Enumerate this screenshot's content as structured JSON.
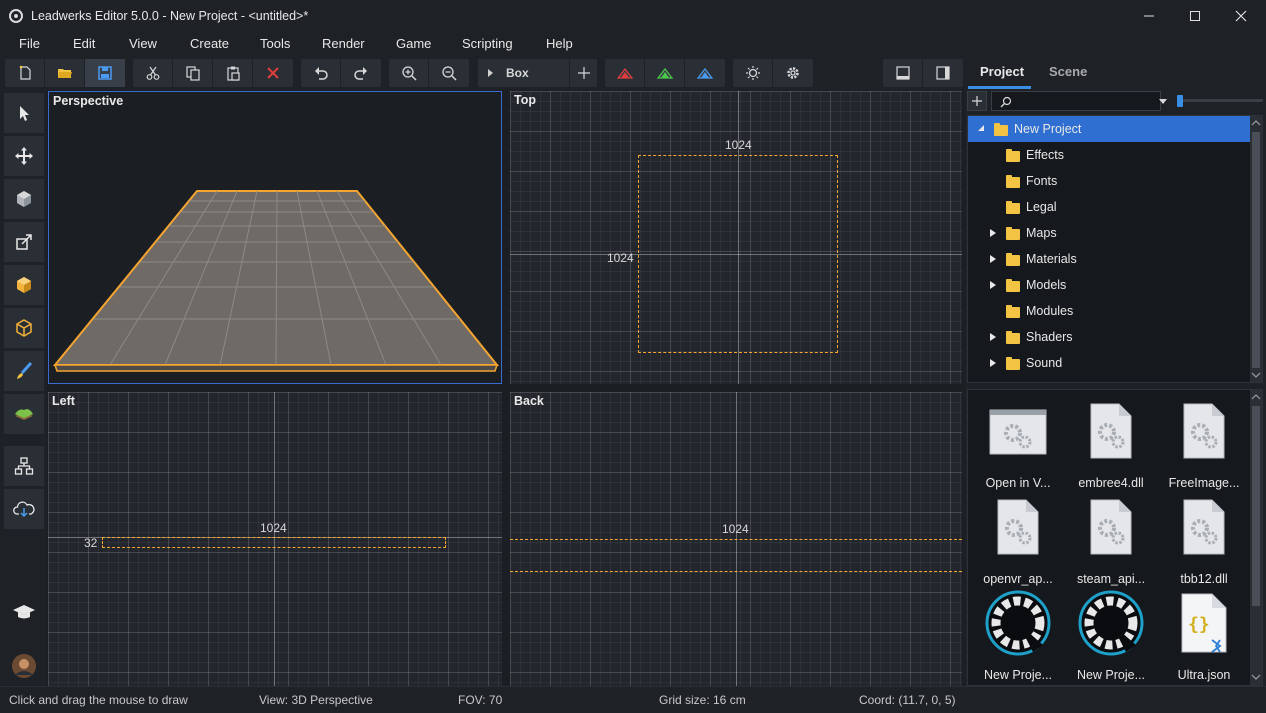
{
  "window": {
    "title": "Leadwerks Editor 5.0.0 - New Project - <untitled>*"
  },
  "menu": [
    "File",
    "Edit",
    "View",
    "Create",
    "Tools",
    "Render",
    "Game",
    "Scripting",
    "Help"
  ],
  "toolbar": {
    "primitive_selector": "Box",
    "icons": [
      "new-file-icon",
      "open-folder-icon",
      "save-icon",
      "cut-icon",
      "copy-icon",
      "paste-icon",
      "delete-icon",
      "undo-icon",
      "redo-icon",
      "zoom-in-icon",
      "zoom-out-icon",
      "play-icon",
      "add-icon",
      "align-red-icon",
      "align-green-icon",
      "align-blue-icon",
      "settings-sun-icon",
      "settings-gear-icon",
      "single-view-icon",
      "panel-view-icon"
    ]
  },
  "tools": [
    "select-arrow-icon",
    "move-icon",
    "rotate-cube-icon",
    "scale-icon",
    "box-solid-icon",
    "box-edit-icon",
    "paint-brush-icon",
    "terrain-icon",
    "hierarchy-icon",
    "cloud-download-icon",
    "graduation-cap-icon",
    "user-avatar"
  ],
  "viewports": {
    "perspective": {
      "label": "Perspective"
    },
    "top": {
      "label": "Top",
      "width_label": "1024",
      "height_label": "1024"
    },
    "left": {
      "label": "Left",
      "width_label": "1024",
      "height_label": "32"
    },
    "back": {
      "label": "Back",
      "width_label": "1024"
    }
  },
  "panel": {
    "tabs": [
      "Project",
      "Scene"
    ],
    "active_tab": "Project",
    "tree": [
      {
        "label": "New Project",
        "expanded": true,
        "selected": true,
        "depth": 0
      },
      {
        "label": "Effects",
        "expandable": false,
        "depth": 1
      },
      {
        "label": "Fonts",
        "expandable": false,
        "depth": 1
      },
      {
        "label": "Legal",
        "expandable": false,
        "depth": 1
      },
      {
        "label": "Maps",
        "expandable": true,
        "depth": 1
      },
      {
        "label": "Materials",
        "expandable": true,
        "depth": 1
      },
      {
        "label": "Models",
        "expandable": true,
        "depth": 1
      },
      {
        "label": "Modules",
        "expandable": false,
        "depth": 1
      },
      {
        "label": "Shaders",
        "expandable": true,
        "depth": 1
      },
      {
        "label": "Sound",
        "expandable": true,
        "depth": 1
      }
    ],
    "assets": [
      {
        "label": "Open in V...",
        "icon": "settings-window-icon"
      },
      {
        "label": "embree4.dll",
        "icon": "dll-file-icon"
      },
      {
        "label": "FreeImage...",
        "icon": "dll-file-icon"
      },
      {
        "label": "openvr_ap...",
        "icon": "dll-file-icon"
      },
      {
        "label": "steam_api...",
        "icon": "dll-file-icon"
      },
      {
        "label": "tbb12.dll",
        "icon": "dll-file-icon"
      },
      {
        "label": "New Proje...",
        "icon": "app-logo-icon"
      },
      {
        "label": "New Proje...",
        "icon": "app-logo-icon"
      },
      {
        "label": "Ultra.json",
        "icon": "json-file-icon"
      }
    ]
  },
  "status": {
    "hint": "Click and drag the mouse to draw",
    "view": "View: 3D Perspective",
    "fov": "FOV: 70",
    "grid": "Grid size: 16 cm",
    "coord": "Coord: (11.7, 0, 5)"
  },
  "colors": {
    "selection_outline": "#f5a530",
    "accent": "#2f6fd1",
    "folder": "#f3c443",
    "delete_red": "#e03c3c"
  }
}
